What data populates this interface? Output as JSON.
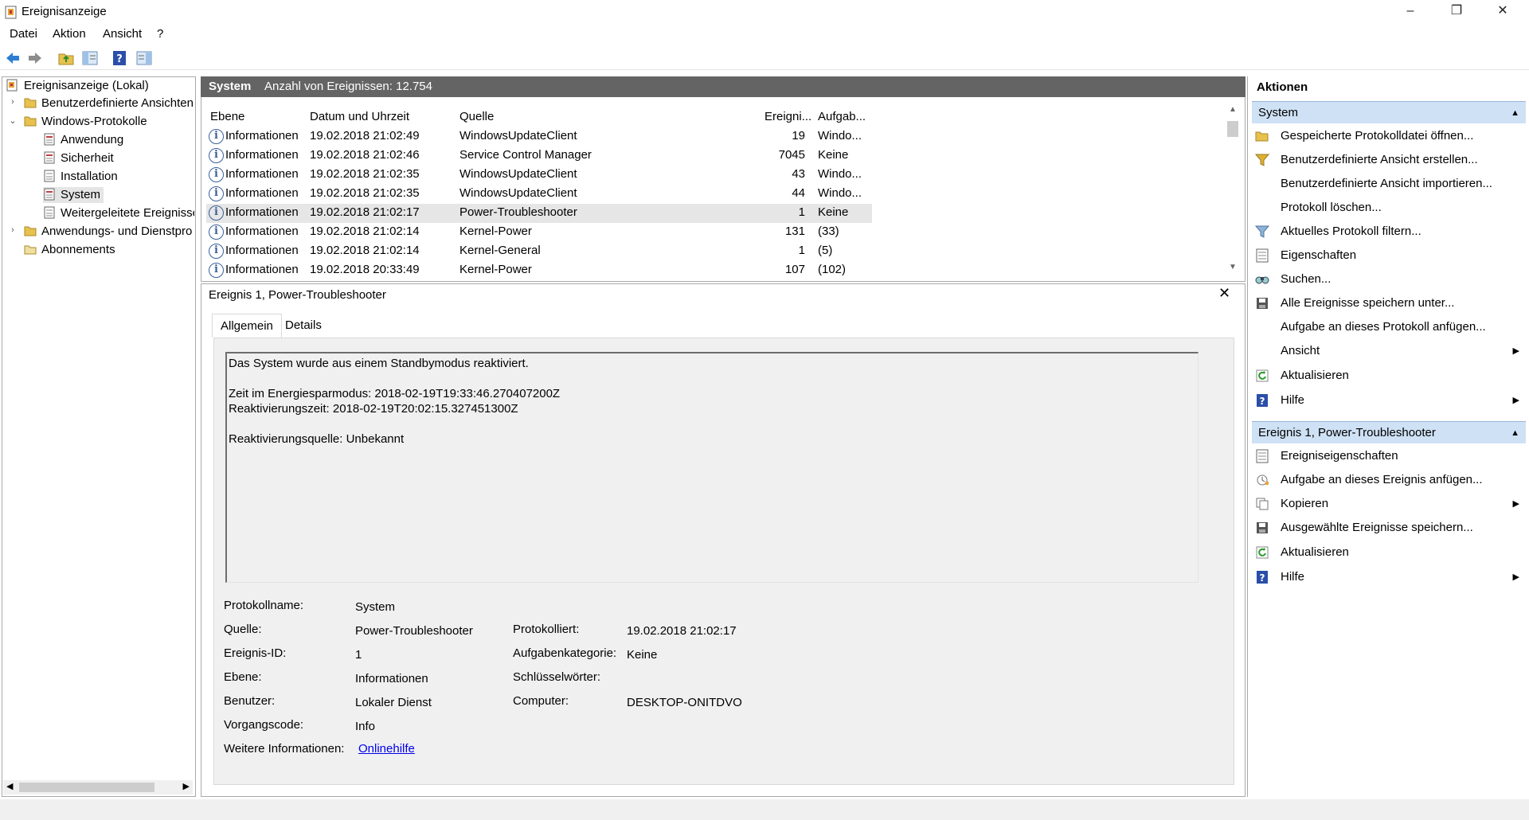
{
  "window": {
    "title": "Ereignisanzeige"
  },
  "menu": [
    "Datei",
    "Aktion",
    "Ansicht",
    "?"
  ],
  "tree": {
    "root": "Ereignisanzeige (Lokal)",
    "custom_views": "Benutzerdefinierte Ansichten",
    "windows_logs": "Windows-Protokolle",
    "logs": [
      "Anwendung",
      "Sicherheit",
      "Installation",
      "System",
      "Weitergeleitete Ereignisse"
    ],
    "app_services": "Anwendungs- und Dienstpro",
    "subscriptions": "Abonnements"
  },
  "list_header": {
    "name": "System",
    "count_label": "Anzahl von Ereignissen: 12.754"
  },
  "columns": [
    "Ebene",
    "Datum und Uhrzeit",
    "Quelle",
    "Ereigni...",
    "Aufgab..."
  ],
  "events": [
    {
      "level": "Informationen",
      "date": "19.02.2018 21:02:49",
      "source": "WindowsUpdateClient",
      "id": "19",
      "task": "Windo..."
    },
    {
      "level": "Informationen",
      "date": "19.02.2018 21:02:46",
      "source": "Service Control Manager",
      "id": "7045",
      "task": "Keine"
    },
    {
      "level": "Informationen",
      "date": "19.02.2018 21:02:35",
      "source": "WindowsUpdateClient",
      "id": "43",
      "task": "Windo..."
    },
    {
      "level": "Informationen",
      "date": "19.02.2018 21:02:35",
      "source": "WindowsUpdateClient",
      "id": "44",
      "task": "Windo..."
    },
    {
      "level": "Informationen",
      "date": "19.02.2018 21:02:17",
      "source": "Power-Troubleshooter",
      "id": "1",
      "task": "Keine"
    },
    {
      "level": "Informationen",
      "date": "19.02.2018 21:02:14",
      "source": "Kernel-Power",
      "id": "131",
      "task": "(33)"
    },
    {
      "level": "Informationen",
      "date": "19.02.2018 21:02:14",
      "source": "Kernel-General",
      "id": "1",
      "task": "(5)"
    },
    {
      "level": "Informationen",
      "date": "19.02.2018 20:33:49",
      "source": "Kernel-Power",
      "id": "107",
      "task": "(102)"
    }
  ],
  "detail": {
    "title": "Ereignis 1, Power-Troubleshooter",
    "tabs": [
      "Allgemein",
      "Details"
    ],
    "message": [
      "Das System wurde aus einem Standbymodus reaktiviert.",
      "Zeit im Energiesparmodus: 2018-02-19T19:33:46.270407200Z",
      "Reaktivierungszeit: 2018-02-19T20:02:15.327451300Z",
      "Reaktivierungsquelle: Unbekannt"
    ],
    "fields": {
      "log_name_label": "Protokollname:",
      "log_name": "System",
      "source_label": "Quelle:",
      "source": "Power-Troubleshooter",
      "logged_label": "Protokolliert:",
      "logged": "19.02.2018 21:02:17",
      "event_id_label": "Ereignis-ID:",
      "event_id": "1",
      "task_cat_label": "Aufgabenkategorie:",
      "task_cat": "Keine",
      "level_label": "Ebene:",
      "level": "Informationen",
      "keywords_label": "Schlüsselwörter:",
      "user_label": "Benutzer:",
      "user": "Lokaler Dienst",
      "computer_label": "Computer:",
      "computer": "DESKTOP-ONITDVO",
      "opcode_label": "Vorgangscode:",
      "opcode": "Info",
      "more_info_label": "Weitere Informationen:",
      "more_info_link": "Onlinehilfe"
    }
  },
  "actions": {
    "header": "Aktionen",
    "section1": "System",
    "items1": [
      "Gespeicherte Protokolldatei öffnen...",
      "Benutzerdefinierte Ansicht erstellen...",
      "Benutzerdefinierte Ansicht importieren...",
      "Protokoll löschen...",
      "Aktuelles Protokoll filtern...",
      "Eigenschaften",
      "Suchen...",
      "Alle Ereignisse speichern unter...",
      "Aufgabe an dieses Protokoll anfügen...",
      "Ansicht",
      "Aktualisieren",
      "Hilfe"
    ],
    "section2": "Ereignis 1, Power-Troubleshooter",
    "items2": [
      "Ereigniseigenschaften",
      "Aufgabe an dieses Ereignis anfügen...",
      "Kopieren",
      "Ausgewählte Ereignisse speichern...",
      "Aktualisieren",
      "Hilfe"
    ]
  }
}
